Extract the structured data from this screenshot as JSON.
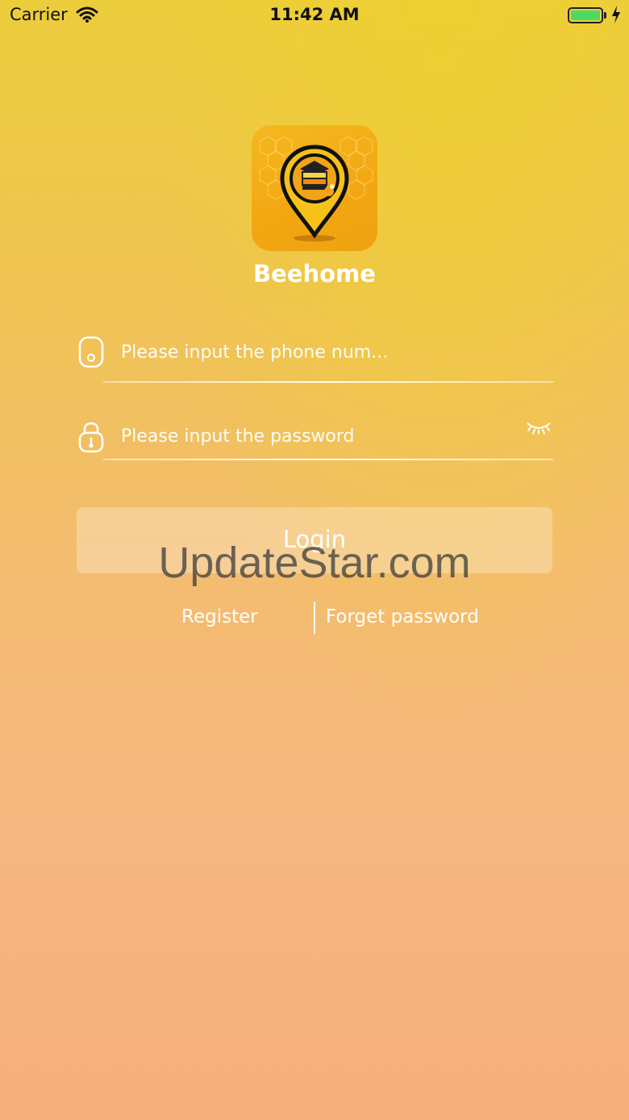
{
  "status_bar": {
    "carrier": "Carrier",
    "time": "11:42 AM",
    "battery_color": "#4cd964"
  },
  "app": {
    "name": "Beehome",
    "logo_icon": "bee-location-pin-icon"
  },
  "form": {
    "phone_placeholder": "Please input the phone num...",
    "password_placeholder": "Please input the password",
    "phone_icon": "phone-icon",
    "lock_icon": "lock-icon",
    "eye_icon": "eye-closed-icon"
  },
  "actions": {
    "login_label": "Login",
    "register_label": "Register",
    "forget_label": "Forget password"
  },
  "watermark": "UpdateStar.com",
  "colors": {
    "gradient_top": "#eccd3c",
    "gradient_bottom": "#f5ae7a",
    "logo_bg": "#f3a812",
    "text": "#ffffff"
  }
}
